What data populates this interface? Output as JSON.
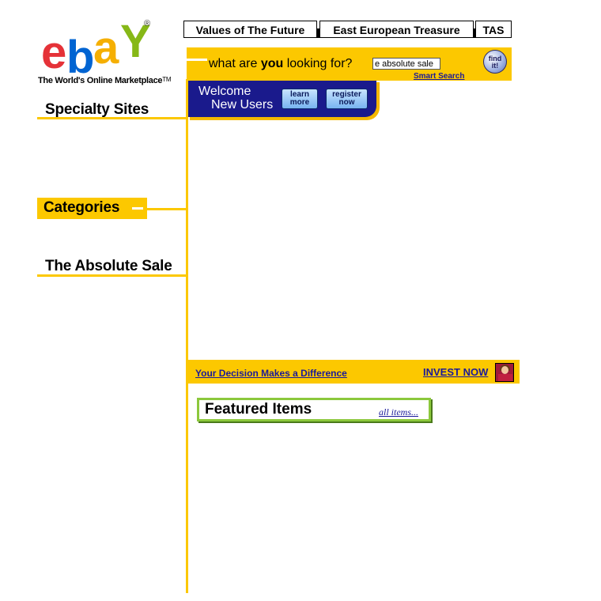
{
  "logo": {
    "letters": [
      "e",
      "b",
      "a",
      "Y"
    ],
    "reg_mark": "®",
    "tagline": "The World's Online Marketplace",
    "tm": "TM",
    "colors": {
      "e": "#e53238",
      "b": "#0064d2",
      "a": "#f5af02",
      "y": "#86b817"
    }
  },
  "tabs": [
    {
      "label": "Values of The Future"
    },
    {
      "label": "East European Treasure"
    },
    {
      "label": "TAS"
    }
  ],
  "search": {
    "prompt_pre": "what are ",
    "prompt_bold": "you",
    "prompt_post": " looking for?",
    "value": "e absolute sale",
    "smart_search": "Smart Search",
    "find_line1": "find",
    "find_line2": "it!"
  },
  "welcome": {
    "line1": "Welcome",
    "line2": "New Users",
    "learn_line1": "learn",
    "learn_line2": "more",
    "register_line1": "register",
    "register_line2": "now"
  },
  "nav": {
    "specialty": "Specialty Sites",
    "categories": "Categories",
    "absolute_sale": "The Absolute Sale"
  },
  "invest": {
    "decision": "Your Decision Makes a Difference",
    "invest_now": "INVEST NOW"
  },
  "featured": {
    "title": "Featured Items",
    "all_items": "all items..."
  },
  "colors": {
    "accent_yellow": "#fcc800",
    "navy": "#1a1a8c",
    "link": "#1a1a9a",
    "featured_green": "#8cc83c"
  }
}
